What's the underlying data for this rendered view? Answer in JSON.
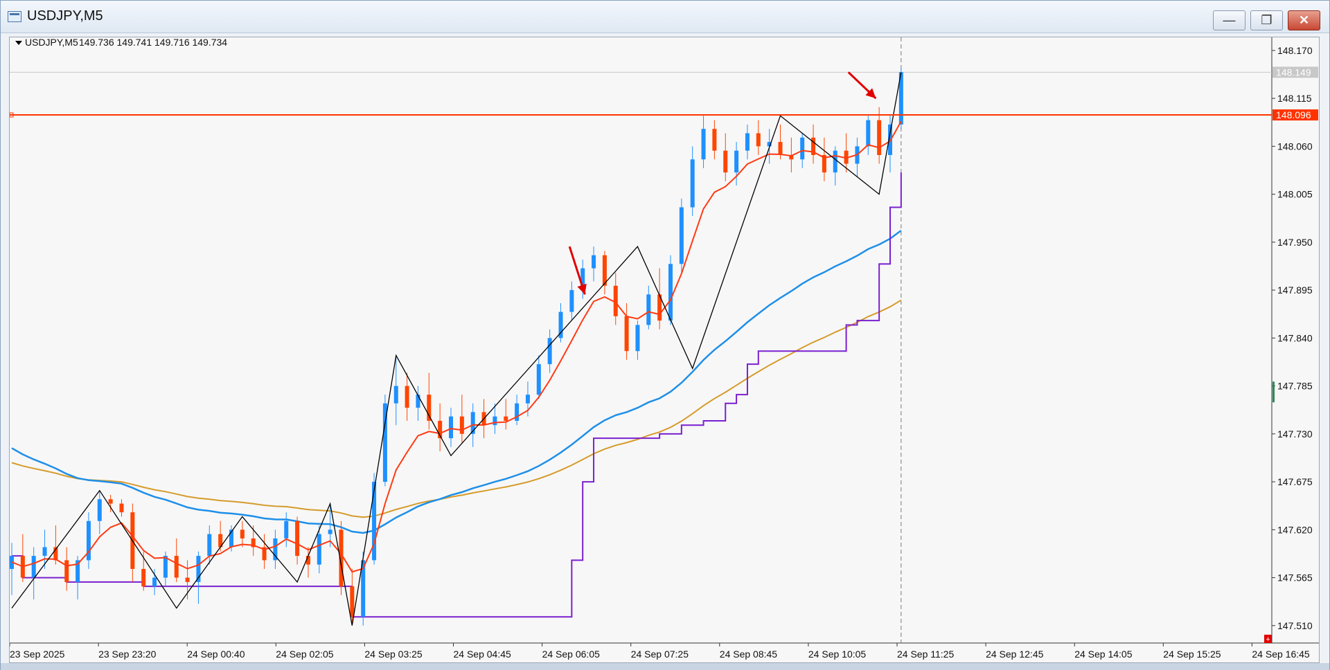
{
  "window": {
    "title": "USDJPY,M5",
    "buttons": [
      "—",
      "❐",
      "✕"
    ]
  },
  "chart_data": {
    "type": "line",
    "symbol_label": "USDJPY,M5",
    "ohlc_text": "149.736 149.741 149.716 149.734",
    "price_ticks": [
      "148.170",
      "148.115",
      "148.060",
      "148.005",
      "147.950",
      "147.895",
      "147.840",
      "147.785",
      "147.730",
      "147.675",
      "147.620",
      "147.565",
      "147.510"
    ],
    "price_labels": {
      "current": "148.149",
      "horizontal_line": "148.096"
    },
    "time_labels": [
      "23 Sep 2025",
      "23 Sep 23:20",
      "24 Sep 00:40",
      "24 Sep 02:05",
      "24 Sep 03:25",
      "24 Sep 04:45",
      "24 Sep 06:05",
      "24 Sep 07:25",
      "24 Sep 08:45",
      "24 Sep 10:05",
      "24 Sep 11:25",
      "24 Sep 12:45",
      "24 Sep 14:05",
      "24 Sep 15:25",
      "24 Sep 16:45"
    ],
    "ylim": [
      147.49,
      148.185
    ],
    "horizontal_line_value": 148.096,
    "colors": {
      "bull": "#1e90ff",
      "bear": "#ff4500",
      "ema_fast": "#ff3a12",
      "ema_mid": "#1e8fe8",
      "ema_slow": "#d59b2a",
      "step_line": "#7a1fd0",
      "zigzag": "#000000",
      "hline": "#ff3300",
      "arrow": "#e10000",
      "current_label_bg": "#c8c8c8",
      "hline_label_bg": "#ff3300"
    },
    "zigzag": [
      [
        0,
        147.53
      ],
      [
        8,
        147.665
      ],
      [
        15,
        147.53
      ],
      [
        21,
        147.635
      ],
      [
        26,
        147.56
      ],
      [
        29,
        147.65
      ],
      [
        31,
        147.51
      ],
      [
        35,
        147.82
      ],
      [
        40,
        147.705
      ],
      [
        57,
        147.945
      ],
      [
        62,
        147.805
      ],
      [
        70,
        148.095
      ],
      [
        79,
        148.005
      ],
      [
        81,
        148.145
      ]
    ],
    "candles": [
      [
        147.575,
        147.605,
        147.545,
        147.59
      ],
      [
        147.59,
        147.615,
        147.56,
        147.565
      ],
      [
        147.565,
        147.6,
        147.54,
        147.59
      ],
      [
        147.59,
        147.62,
        147.575,
        147.6
      ],
      [
        147.6,
        147.625,
        147.58,
        147.585
      ],
      [
        147.585,
        147.6,
        147.55,
        147.56
      ],
      [
        147.56,
        147.59,
        147.54,
        147.585
      ],
      [
        147.585,
        147.64,
        147.575,
        147.63
      ],
      [
        147.63,
        147.665,
        147.615,
        147.655
      ],
      [
        147.655,
        147.66,
        147.64,
        147.65
      ],
      [
        147.65,
        147.655,
        147.635,
        147.64
      ],
      [
        147.64,
        147.65,
        147.56,
        147.575
      ],
      [
        147.575,
        147.595,
        147.55,
        147.555
      ],
      [
        147.555,
        147.575,
        147.545,
        147.565
      ],
      [
        147.565,
        147.595,
        147.555,
        147.59
      ],
      [
        147.59,
        147.61,
        147.56,
        147.565
      ],
      [
        147.565,
        147.585,
        147.54,
        147.56
      ],
      [
        147.56,
        147.595,
        147.535,
        147.59
      ],
      [
        147.59,
        147.625,
        147.58,
        147.615
      ],
      [
        147.615,
        147.63,
        147.595,
        147.6
      ],
      [
        147.6,
        147.625,
        147.595,
        147.62
      ],
      [
        147.62,
        147.63,
        147.6,
        147.61
      ],
      [
        147.61,
        147.625,
        147.59,
        147.6
      ],
      [
        147.6,
        147.615,
        147.575,
        147.585
      ],
      [
        147.585,
        147.62,
        147.575,
        147.61
      ],
      [
        147.61,
        147.64,
        147.6,
        147.63
      ],
      [
        147.63,
        147.635,
        147.58,
        147.59
      ],
      [
        147.59,
        147.6,
        147.565,
        147.58
      ],
      [
        147.58,
        147.625,
        147.57,
        147.615
      ],
      [
        147.615,
        147.65,
        147.6,
        147.62
      ],
      [
        147.62,
        147.63,
        147.545,
        147.555
      ],
      [
        147.555,
        147.575,
        147.51,
        147.52
      ],
      [
        147.52,
        147.595,
        147.51,
        147.585
      ],
      [
        147.585,
        147.685,
        147.58,
        147.675
      ],
      [
        147.675,
        147.775,
        147.67,
        147.765
      ],
      [
        147.765,
        147.82,
        147.74,
        147.785
      ],
      [
        147.785,
        147.8,
        147.745,
        147.76
      ],
      [
        147.76,
        147.785,
        147.745,
        147.775
      ],
      [
        147.775,
        147.8,
        147.735,
        147.745
      ],
      [
        147.745,
        147.765,
        147.71,
        147.725
      ],
      [
        147.725,
        147.76,
        147.715,
        147.75
      ],
      [
        147.75,
        147.775,
        147.72,
        147.73
      ],
      [
        147.73,
        147.765,
        147.715,
        147.755
      ],
      [
        147.755,
        147.77,
        147.725,
        147.74
      ],
      [
        147.74,
        147.765,
        147.73,
        147.75
      ],
      [
        147.75,
        147.77,
        147.735,
        147.745
      ],
      [
        147.745,
        147.775,
        147.74,
        147.765
      ],
      [
        147.765,
        147.79,
        147.75,
        147.775
      ],
      [
        147.775,
        147.82,
        147.77,
        147.81
      ],
      [
        147.81,
        147.85,
        147.8,
        147.84
      ],
      [
        147.84,
        147.88,
        147.835,
        147.87
      ],
      [
        147.87,
        147.905,
        147.86,
        147.895
      ],
      [
        147.895,
        147.93,
        147.885,
        147.92
      ],
      [
        147.92,
        147.945,
        147.905,
        147.935
      ],
      [
        147.935,
        147.94,
        147.89,
        147.9
      ],
      [
        147.9,
        147.915,
        147.855,
        147.865
      ],
      [
        147.865,
        147.88,
        147.815,
        147.825
      ],
      [
        147.825,
        147.86,
        147.815,
        147.855
      ],
      [
        147.855,
        147.9,
        147.85,
        147.89
      ],
      [
        147.89,
        147.92,
        147.85,
        147.86
      ],
      [
        147.86,
        147.935,
        147.855,
        147.925
      ],
      [
        147.925,
        148.0,
        147.915,
        147.99
      ],
      [
        147.99,
        148.06,
        147.98,
        148.045
      ],
      [
        148.045,
        148.095,
        148.035,
        148.08
      ],
      [
        148.08,
        148.09,
        148.045,
        148.055
      ],
      [
        148.055,
        148.075,
        148.02,
        148.03
      ],
      [
        148.03,
        148.065,
        148.015,
        148.055
      ],
      [
        148.055,
        148.085,
        148.045,
        148.075
      ],
      [
        148.075,
        148.09,
        148.05,
        148.06
      ],
      [
        148.06,
        148.08,
        148.04,
        148.065
      ],
      [
        148.065,
        148.085,
        148.045,
        148.05
      ],
      [
        148.05,
        148.07,
        148.03,
        148.045
      ],
      [
        148.045,
        148.075,
        148.035,
        148.07
      ],
      [
        148.07,
        148.085,
        148.04,
        148.05
      ],
      [
        148.05,
        148.07,
        148.02,
        148.03
      ],
      [
        148.03,
        148.06,
        148.015,
        148.055
      ],
      [
        148.055,
        148.075,
        148.03,
        148.04
      ],
      [
        148.04,
        148.07,
        148.025,
        148.06
      ],
      [
        148.06,
        148.095,
        148.05,
        148.09
      ],
      [
        148.09,
        148.105,
        148.04,
        148.05
      ],
      [
        148.05,
        148.095,
        148.03,
        148.085
      ],
      [
        148.085,
        148.15,
        148.08,
        148.145
      ]
    ]
  }
}
